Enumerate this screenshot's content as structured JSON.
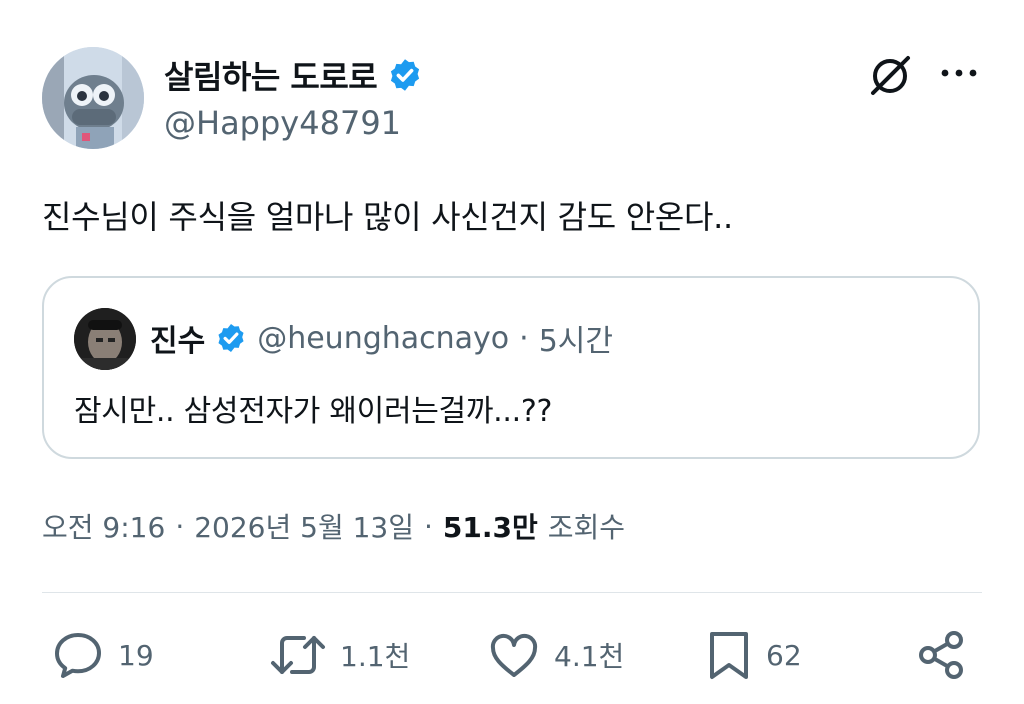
{
  "author": {
    "display_name": "살림하는 도로로",
    "handle": "@Happy48791",
    "verified_icon": "verified-badge-icon",
    "avatar_icon": "avatar"
  },
  "tweet": {
    "text": "진수님이 주식을 얼마나 많이 사신건지 감도 안온다.."
  },
  "quote": {
    "display_name": "진수",
    "handle": "@heunghacnayo",
    "separator": "·",
    "time": "5시간",
    "text": "잠시만.. 삼성전자가 왜이러는걸까...??"
  },
  "meta": {
    "time": "오전 9:16",
    "separator_1": "·",
    "date": "2026년 5월 13일",
    "separator_2": "·",
    "views_count": "51.3만",
    "views_label": "조회수"
  },
  "actions": {
    "replies": "19",
    "reposts": "1.1천",
    "likes": "4.1천",
    "bookmarks": "62"
  },
  "colors": {
    "verified": "#1d9bf0",
    "muted_text": "#536471",
    "border": "#cfd9de"
  }
}
